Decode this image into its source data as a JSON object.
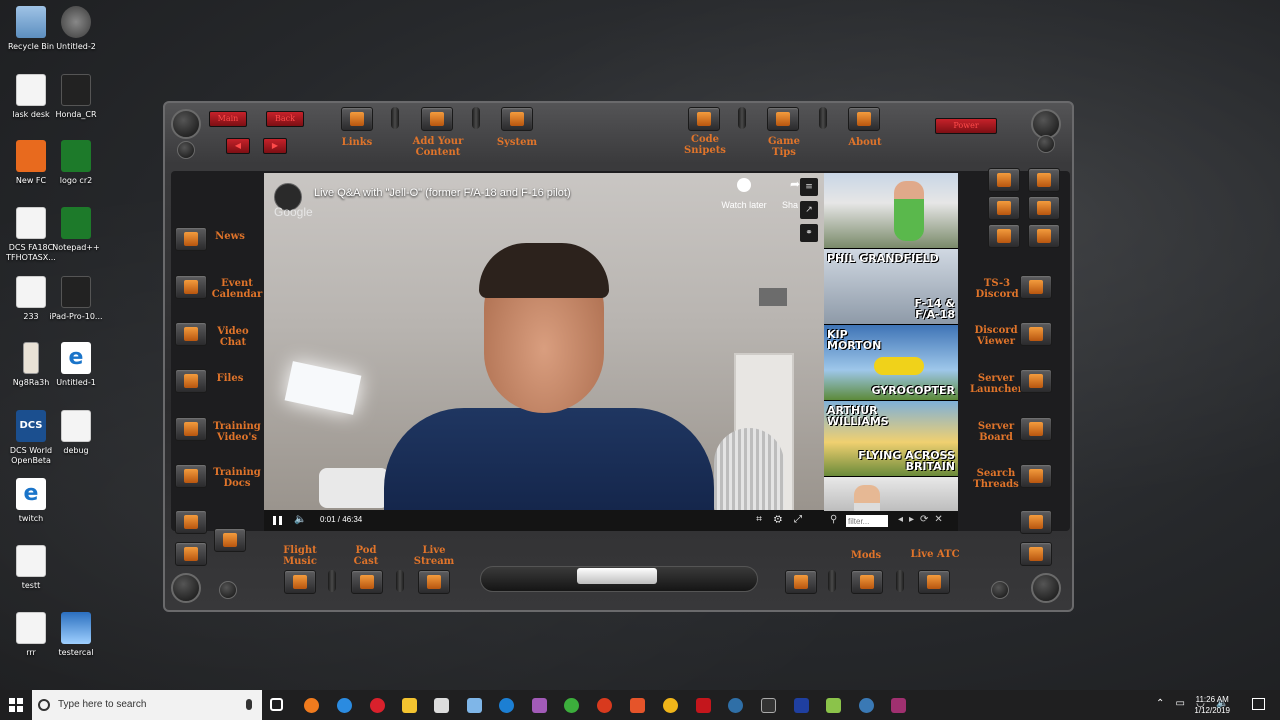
{
  "desktop": {
    "icons_col1": [
      "Recycle Bin",
      "lask desk",
      "New FC",
      "DCS FA18C TFHOTASX...",
      "233",
      "Ng8Ra3h",
      "DCS World OpenBeta",
      "twitch",
      "testt",
      "rrr"
    ],
    "icons_col2": [
      "Untitled-2",
      "Honda_CR",
      "logo cr2",
      "Notepad++",
      "iPad-Pro-10...",
      "Untitled-1",
      "debug",
      "testercal"
    ]
  },
  "panel": {
    "top_red": {
      "main": "Main",
      "back": "Back",
      "power": "Power"
    },
    "top_buttons": {
      "links": "Links",
      "add_content": "Add Your Content",
      "system": "System",
      "code_snippets": "Code Snipets",
      "game_tips": "Game Tips",
      "about": "About"
    },
    "left_buttons": {
      "news": "News",
      "event_calendar": "Event Calendar",
      "video_chat": "Video Chat",
      "files": "Files",
      "training_videos": "Training Video's",
      "training_docs": "Training Docs"
    },
    "right_buttons": {
      "ts3_discord": "TS-3 Discord",
      "discord_viewer": "Discord Viewer",
      "server_launcher": "Server Launcher",
      "server_board": "Server Board",
      "search_threads": "Search Threads"
    },
    "bottom_buttons": {
      "flight_music": "Flight Music",
      "pod_cast": "Pod Cast",
      "live_stream": "Live Stream",
      "mods": "Mods",
      "live_atc": "Live ATC"
    }
  },
  "player": {
    "title": "Live Q&A with \"Jell-O\" (former F/A-18 and F-16 pilot)",
    "brand": "Google",
    "watch_later": "Watch later",
    "share": "Sha",
    "time": "0:01 / 46:34",
    "filter_placeholder": "filter..."
  },
  "thumbnails": [
    {
      "top": "",
      "bottom": ""
    },
    {
      "top": "PHIL GRANDFIELD",
      "bottom": "F-14 & F/A-18"
    },
    {
      "top": "KIP MORTON",
      "bottom": "GYROCOPTER"
    },
    {
      "top": "ARTHUR WILLIAMS",
      "bottom": "FLYING ACROSS BRITAIN"
    },
    {
      "top": "",
      "bottom": ""
    }
  ],
  "taskbar": {
    "search_placeholder": "Type here to search",
    "time": "11:26 AM",
    "date": "1/12/2019"
  },
  "colors": {
    "accent": "#e0742a",
    "panel": "#2b2b2d",
    "red": "#c6222a"
  }
}
